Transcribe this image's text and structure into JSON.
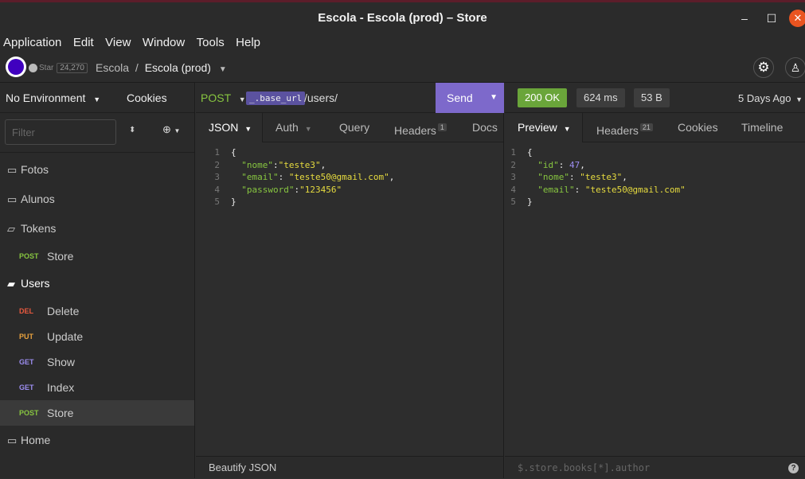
{
  "window": {
    "title": "Escola - Escola (prod) – Store"
  },
  "menu": [
    "Application",
    "Edit",
    "View",
    "Window",
    "Tools",
    "Help"
  ],
  "topbar": {
    "star_label": "Star",
    "star_count": "24,270",
    "crumb_workspace": "Escola",
    "crumb_separator": "/",
    "crumb_env": "Escola (prod)"
  },
  "sidebar": {
    "environment": "No Environment",
    "cookies": "Cookies",
    "filter_placeholder": "Filter",
    "folders": {
      "fotos": "Fotos",
      "alunos": "Alunos",
      "tokens": "Tokens",
      "users": "Users",
      "home": "Home"
    },
    "requests": {
      "tokens_store": {
        "method": "POST",
        "label": "Store"
      },
      "users_delete": {
        "method": "DEL",
        "label": "Delete"
      },
      "users_update": {
        "method": "PUT",
        "label": "Update"
      },
      "users_show": {
        "method": "GET",
        "label": "Show"
      },
      "users_index": {
        "method": "GET",
        "label": "Index"
      },
      "users_store": {
        "method": "POST",
        "label": "Store"
      }
    }
  },
  "request": {
    "method": "POST",
    "url_tag": "_.base_url",
    "url_path": "/users/",
    "send": "Send",
    "tabs": {
      "json": "JSON",
      "auth": "Auth",
      "query": "Query",
      "headers": "Headers",
      "headers_count": "1",
      "docs": "Docs"
    },
    "body_lines": [
      {
        "n": "1",
        "text": "{"
      },
      {
        "n": "2",
        "key": "\"nome\"",
        "sep": ":",
        "val": "\"teste3\"",
        "end": ","
      },
      {
        "n": "3",
        "key": "\"email\"",
        "sep": ": ",
        "val": "\"teste50@gmail.com\"",
        "end": ","
      },
      {
        "n": "4",
        "key": "\"password\"",
        "sep": ":",
        "val": "\"123456\"",
        "end": ""
      },
      {
        "n": "5",
        "text": "}"
      }
    ],
    "footer": "Beautify JSON"
  },
  "response": {
    "status": "200 OK",
    "time": "624 ms",
    "size": "53 B",
    "ago": "5 Days Ago",
    "tabs": {
      "preview": "Preview",
      "headers": "Headers",
      "headers_count": "21",
      "cookies": "Cookies",
      "timeline": "Timeline"
    },
    "body_lines": [
      {
        "n": "1",
        "text": "{"
      },
      {
        "n": "2",
        "key": "\"id\"",
        "sep": ": ",
        "val": "47",
        "end": ",",
        "num": true
      },
      {
        "n": "3",
        "key": "\"nome\"",
        "sep": ": ",
        "val": "\"teste3\"",
        "end": ","
      },
      {
        "n": "4",
        "key": "\"email\"",
        "sep": ": ",
        "val": "\"teste50@gmail.com\"",
        "end": ""
      },
      {
        "n": "5",
        "text": "}"
      }
    ],
    "filter_placeholder": "$.store.books[*].author"
  }
}
